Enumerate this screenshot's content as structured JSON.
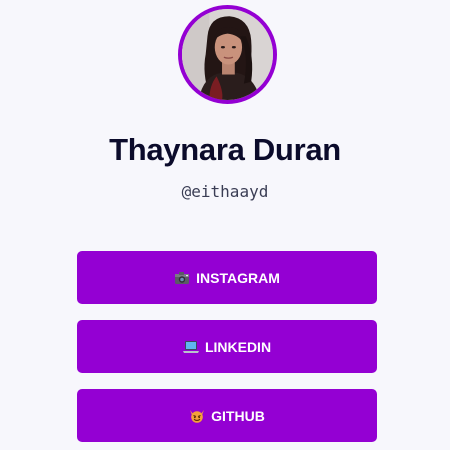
{
  "profile": {
    "name": "Thaynara Duran",
    "handle": "@eithaayd",
    "avatar_border_color": "#9400d3"
  },
  "links": [
    {
      "label": "INSTAGRAM",
      "icon": "camera-icon"
    },
    {
      "label": "LINKEDIN",
      "icon": "laptop-icon"
    },
    {
      "label": "GITHUB",
      "icon": "devil-face-icon"
    }
  ],
  "colors": {
    "accent": "#9400d3",
    "background": "#f7f7fc",
    "name_text": "#0b0b2b"
  }
}
